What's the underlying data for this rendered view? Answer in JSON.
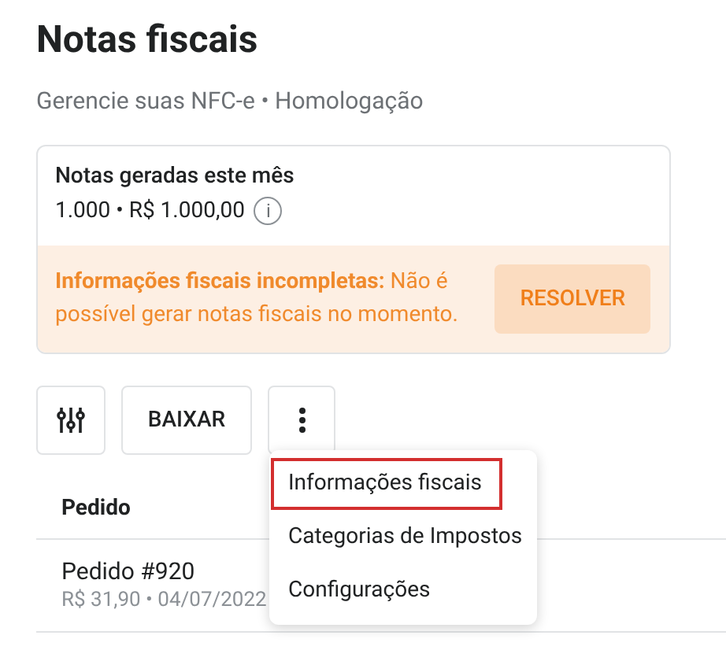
{
  "header": {
    "title": "Notas fiscais",
    "subtitle": "Gerencie suas NFC-e • Homologação"
  },
  "summary": {
    "label": "Notas geradas este mês",
    "value": "1.000 • R$ 1.000,00",
    "info_icon": "i"
  },
  "warning": {
    "text": "**Informações fiscais incompletas:** Não é possível gerar notas fiscais no momento.",
    "button": "RESOLVER"
  },
  "toolbar": {
    "download_button": "BAIXAR"
  },
  "menu": {
    "items": [
      {
        "label": "Informações fiscais",
        "selected": true
      },
      {
        "label": "Categorias de Impostos",
        "selected": false
      },
      {
        "label": "Configurações",
        "selected": false
      }
    ]
  },
  "table": {
    "columns": [
      "Pedido"
    ],
    "rows": [
      {
        "title": "Pedido #920",
        "subtitle": "R$ 31,90 • 04/07/2022"
      }
    ]
  }
}
